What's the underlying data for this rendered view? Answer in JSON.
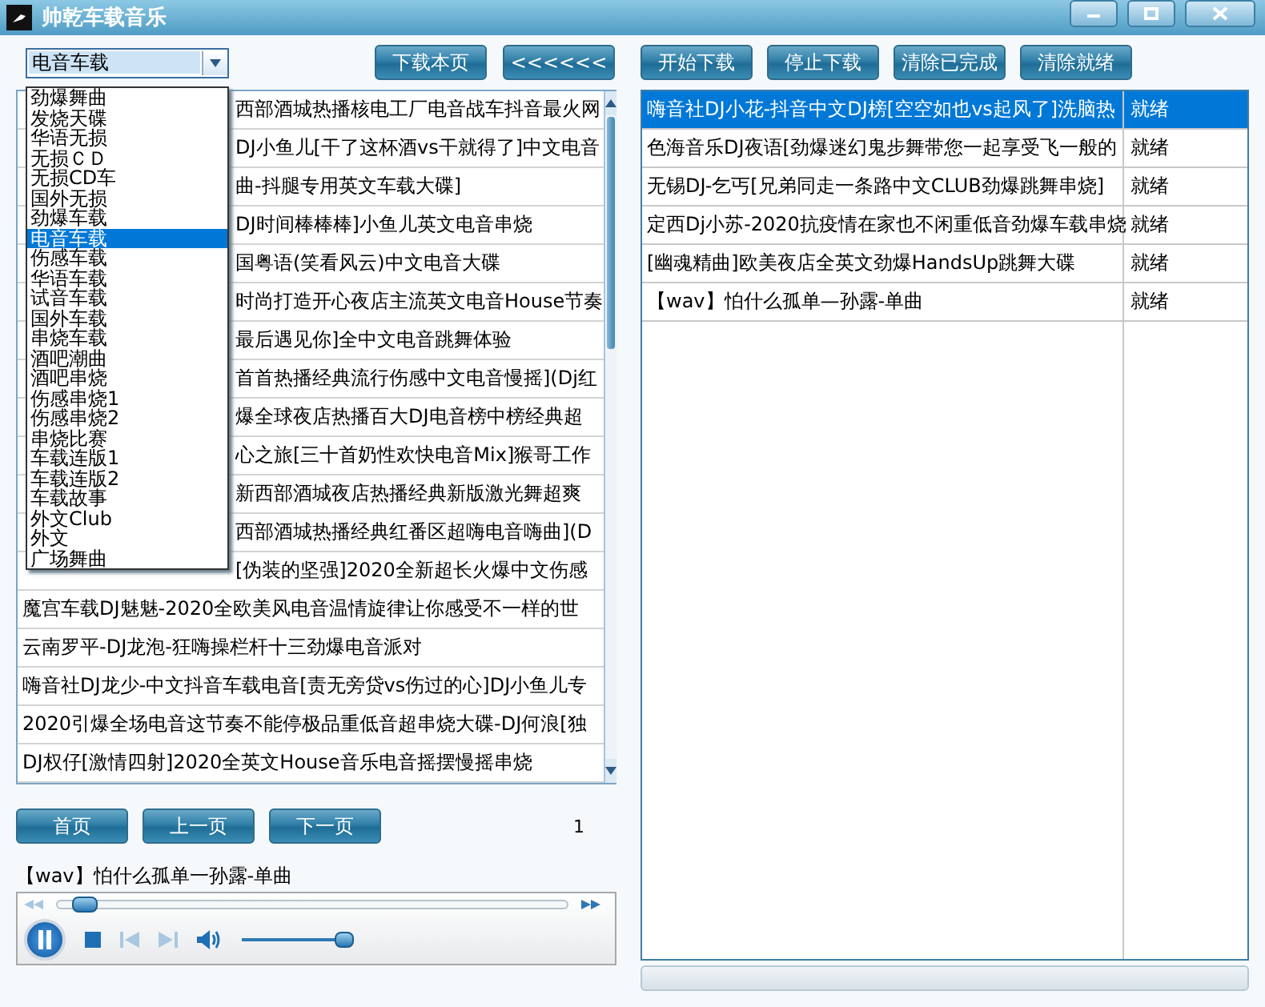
{
  "window": {
    "title": "帅乾车载音乐"
  },
  "toolbar": {
    "category": {
      "value": "电音车载",
      "options": [
        {
          "label": "劲爆舞曲",
          "selected": false
        },
        {
          "label": "发烧天碟",
          "selected": false
        },
        {
          "label": "华语无损",
          "selected": false
        },
        {
          "label": "无损ＣＤ",
          "selected": false
        },
        {
          "label": "无损CD车",
          "selected": false
        },
        {
          "label": "国外无损",
          "selected": false
        },
        {
          "label": "劲爆车载",
          "selected": false
        },
        {
          "label": "电音车载",
          "selected": true
        },
        {
          "label": "伤感车载",
          "selected": false
        },
        {
          "label": "华语车载",
          "selected": false
        },
        {
          "label": "试音车载",
          "selected": false
        },
        {
          "label": "国外车载",
          "selected": false
        },
        {
          "label": "串烧车载",
          "selected": false
        },
        {
          "label": "酒吧潮曲",
          "selected": false
        },
        {
          "label": "酒吧串烧",
          "selected": false
        },
        {
          "label": "伤感串烧1",
          "selected": false
        },
        {
          "label": "伤感串烧2",
          "selected": false
        },
        {
          "label": "串烧比赛",
          "selected": false
        },
        {
          "label": "车载连版1",
          "selected": false
        },
        {
          "label": "车载连版2",
          "selected": false
        },
        {
          "label": "车载故事",
          "selected": false
        },
        {
          "label": "外文Club",
          "selected": false
        },
        {
          "label": "外文",
          "selected": false
        },
        {
          "label": "广场舞曲",
          "selected": false
        }
      ]
    },
    "left_buttons": [
      "下载本页",
      "<<<<<<"
    ],
    "right_buttons": [
      "开始下载",
      "停止下载",
      "清除已完成",
      "清除就绪"
    ]
  },
  "song_list": [
    {
      "kind": "clipped",
      "text": "西部酒城热播核电工厂电音战车抖音最火网"
    },
    {
      "kind": "clipped",
      "text": "DJ小鱼儿[干了这杯酒vs干就得了]中文电音"
    },
    {
      "kind": "clipped",
      "text": "曲-抖腿专用英文车载大碟]"
    },
    {
      "kind": "clipped",
      "text": "DJ时间棒棒棒]小鱼儿英文电音串烧"
    },
    {
      "kind": "clipped",
      "text": "国粤语(笑看风云)中文电音大碟"
    },
    {
      "kind": "clipped",
      "text": "时尚打造开心夜店主流英文电音House节奏"
    },
    {
      "kind": "clipped",
      "text": "最后遇见你]全中文电音跳舞体验"
    },
    {
      "kind": "clipped",
      "text": "首首热播经典流行伤感中文电音慢摇](Dj红"
    },
    {
      "kind": "clipped",
      "text": "爆全球夜店热播百大DJ电音榜中榜经典超"
    },
    {
      "kind": "clipped",
      "text": "心之旅[三十首奶性欢快电音Mix]猴哥工作"
    },
    {
      "kind": "clipped",
      "text": "新西部酒城夜店热播经典新版激光舞超爽"
    },
    {
      "kind": "clipped",
      "text": "西部酒城热播经典红番区超嗨电音嗨曲](D"
    },
    {
      "kind": "clipped",
      "text": "[伪装的坚强]2020全新超长火爆中文伤感"
    },
    {
      "kind": "full",
      "text": "魔宫车载DJ魅魅-2020全欧美风电音温情旋律让你感受不一样的世"
    },
    {
      "kind": "full",
      "text": "云南罗平-DJ龙泡-狂嗨操栏杆十三劲爆电音派对"
    },
    {
      "kind": "full",
      "text": "嗨音社DJ龙少-中文抖音车载电音[责无旁贷vs伤过的心]DJ小鱼儿专"
    },
    {
      "kind": "full",
      "text": "2020引爆全场电音这节奏不能停极品重低音超串烧大碟-DJ何浪[独"
    },
    {
      "kind": "full",
      "text": "DJ权仔[激情四射]2020全英文House音乐电音摇摆慢摇串烧"
    }
  ],
  "pager": {
    "buttons": [
      "首页",
      "上一页",
      "下一页"
    ],
    "page": "1"
  },
  "now_playing": "【wav】怕什么孤单一孙露-单曲",
  "player": {
    "playing": true,
    "position": {
      "level": 0.05
    },
    "volume": {
      "level": 0.8
    }
  },
  "download_queue": [
    {
      "title": "嗨音社DJ小花-抖音中文DJ榜[空空如也vs起风了]洗脑热",
      "status": "就绪",
      "selected": true
    },
    {
      "title": "色海音乐DJ夜语[劲爆迷幻鬼步舞带您一起享受飞一般的",
      "status": "就绪",
      "selected": false
    },
    {
      "title": "无锡DJ-乞丐[兄弟同走一条路中文CLUB劲爆跳舞串烧]",
      "status": "就绪",
      "selected": false
    },
    {
      "title": "定西Dj小苏-2020抗疫情在家也不闲重低音劲爆车载串烧",
      "status": "就绪",
      "selected": false
    },
    {
      "title": "[幽魂精曲]欧美夜店全英文劲爆HandsUp跳舞大碟",
      "status": "就绪",
      "selected": false
    },
    {
      "title": "【wav】怕什么孤单—孙露-单曲",
      "status": "就绪",
      "selected": false
    }
  ]
}
